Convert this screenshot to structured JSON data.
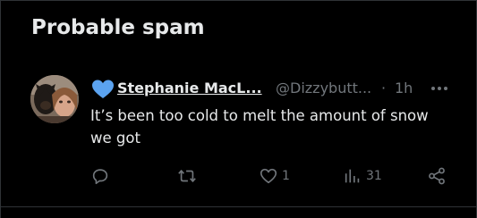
{
  "section": {
    "title": "Probable spam"
  },
  "tweet": {
    "display_name": "Stephanie MacL...",
    "handle": "@Dizzybutt...",
    "separator": "·",
    "time": "1h",
    "text": "It’s been too cold to melt the amount of snow we got",
    "badge_icon": "blue-heart-icon",
    "more_icon": "more-horizontal-icon"
  },
  "actions": {
    "reply": {
      "icon": "reply-icon"
    },
    "retweet": {
      "icon": "retweet-icon"
    },
    "like": {
      "icon": "like-icon",
      "count": "1"
    },
    "views": {
      "icon": "views-icon",
      "count": "31"
    },
    "share": {
      "icon": "share-icon"
    }
  },
  "colors": {
    "background": "#000000",
    "text_primary": "#e7e9ea",
    "text_secondary": "#71767b",
    "border": "#2f3336",
    "heart": "#5ba3f0"
  }
}
